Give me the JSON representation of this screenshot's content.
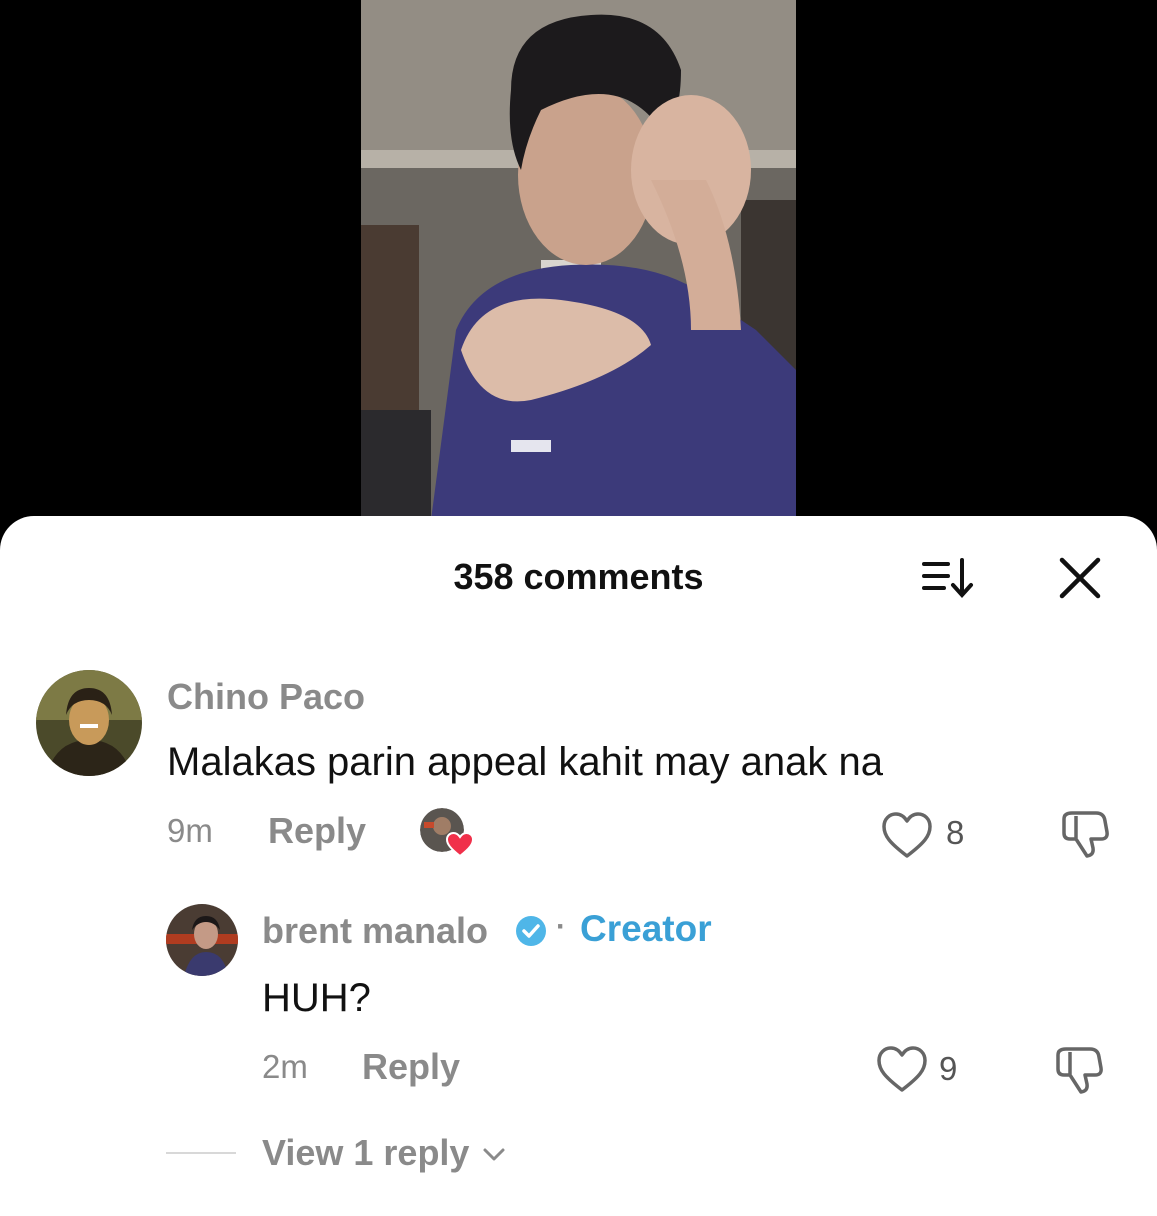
{
  "video": {
    "thumbnail_icon": "video-frame"
  },
  "panel": {
    "title": "358 comments",
    "sort_icon": "sort-icon",
    "close_icon": "close-icon"
  },
  "comments": [
    {
      "author": "Chino Paco",
      "text": "Malakas parin appeal kahit may anak na",
      "time": "9m",
      "reply_label": "Reply",
      "likes": "8",
      "creator_liked": true
    }
  ],
  "reply": {
    "author": "brent manalo",
    "verified": true,
    "separator": "·",
    "badge": "Creator",
    "text": "HUH?",
    "time": "2m",
    "reply_label": "Reply",
    "likes": "9"
  },
  "view_replies": "View 1 reply",
  "colors": {
    "accent": "#3aa0d6",
    "like_heart": "#f0304a"
  }
}
